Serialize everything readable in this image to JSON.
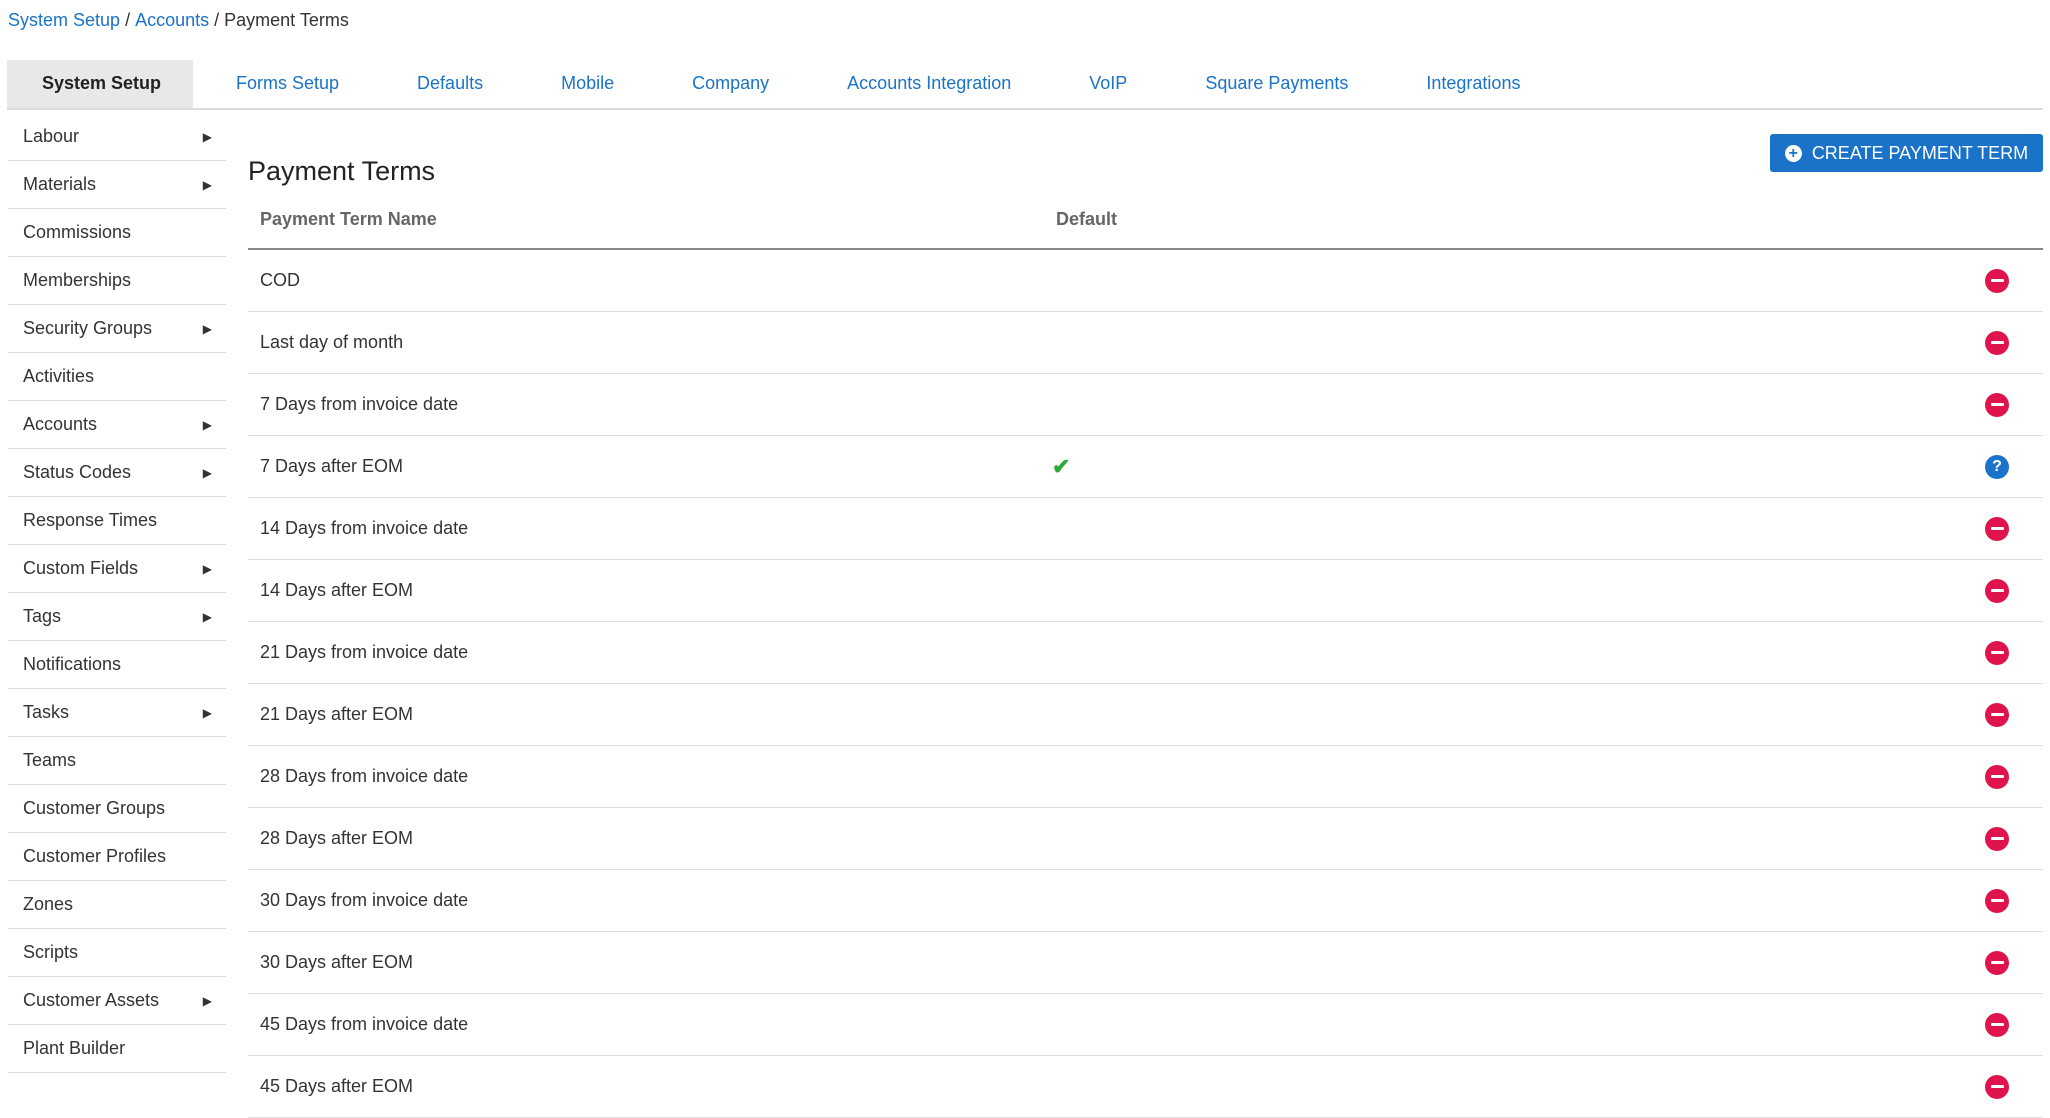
{
  "breadcrumb": {
    "crumb1": "System Setup",
    "crumb2": "Accounts",
    "current": "Payment Terms",
    "separator": "/"
  },
  "tabs": [
    {
      "label": "System Setup",
      "active": true
    },
    {
      "label": "Forms Setup"
    },
    {
      "label": "Defaults"
    },
    {
      "label": "Mobile"
    },
    {
      "label": "Company"
    },
    {
      "label": "Accounts Integration"
    },
    {
      "label": "VoIP"
    },
    {
      "label": "Square Payments"
    },
    {
      "label": "Integrations"
    }
  ],
  "sidebar": {
    "items": [
      {
        "label": "Labour",
        "has_submenu": true
      },
      {
        "label": "Materials",
        "has_submenu": true
      },
      {
        "label": "Commissions",
        "has_submenu": false
      },
      {
        "label": "Memberships",
        "has_submenu": false
      },
      {
        "label": "Security Groups",
        "has_submenu": true
      },
      {
        "label": "Activities",
        "has_submenu": false
      },
      {
        "label": "Accounts",
        "has_submenu": true
      },
      {
        "label": "Status Codes",
        "has_submenu": true
      },
      {
        "label": "Response Times",
        "has_submenu": false
      },
      {
        "label": "Custom Fields",
        "has_submenu": true
      },
      {
        "label": "Tags",
        "has_submenu": true
      },
      {
        "label": "Notifications",
        "has_submenu": false
      },
      {
        "label": "Tasks",
        "has_submenu": true
      },
      {
        "label": "Teams",
        "has_submenu": false
      },
      {
        "label": "Customer Groups",
        "has_submenu": false
      },
      {
        "label": "Customer Profiles",
        "has_submenu": false
      },
      {
        "label": "Zones",
        "has_submenu": false
      },
      {
        "label": "Scripts",
        "has_submenu": false
      },
      {
        "label": "Customer Assets",
        "has_submenu": true
      },
      {
        "label": "Plant Builder",
        "has_submenu": false
      }
    ]
  },
  "main": {
    "title": "Payment Terms",
    "create_button": "CREATE PAYMENT TERM",
    "columns": {
      "name": "Payment Term Name",
      "default": "Default"
    },
    "rows": [
      {
        "name": "COD",
        "default": false
      },
      {
        "name": "Last day of month",
        "default": false
      },
      {
        "name": "7 Days from invoice date",
        "default": false
      },
      {
        "name": "7 Days after EOM",
        "default": true
      },
      {
        "name": "14 Days from invoice date",
        "default": false
      },
      {
        "name": "14 Days after EOM",
        "default": false
      },
      {
        "name": "21 Days from invoice date",
        "default": false
      },
      {
        "name": "21 Days after EOM",
        "default": false
      },
      {
        "name": "28 Days from invoice date",
        "default": false
      },
      {
        "name": "28 Days after EOM",
        "default": false
      },
      {
        "name": "30 Days from invoice date",
        "default": false
      },
      {
        "name": "30 Days after EOM",
        "default": false
      },
      {
        "name": "45 Days from invoice date",
        "default": false
      },
      {
        "name": "45 Days after EOM",
        "default": false
      }
    ]
  },
  "icons": {
    "submenu": "triangle-right-icon",
    "remove": "minus-circle-icon",
    "help": "question-circle-icon",
    "default_check": "check-icon",
    "create": "plus-circle-icon"
  },
  "colors": {
    "link": "#1a73c8",
    "remove": "#e0144c",
    "check": "#2eaa3c",
    "active_tab_bg": "#e8e8e8"
  }
}
